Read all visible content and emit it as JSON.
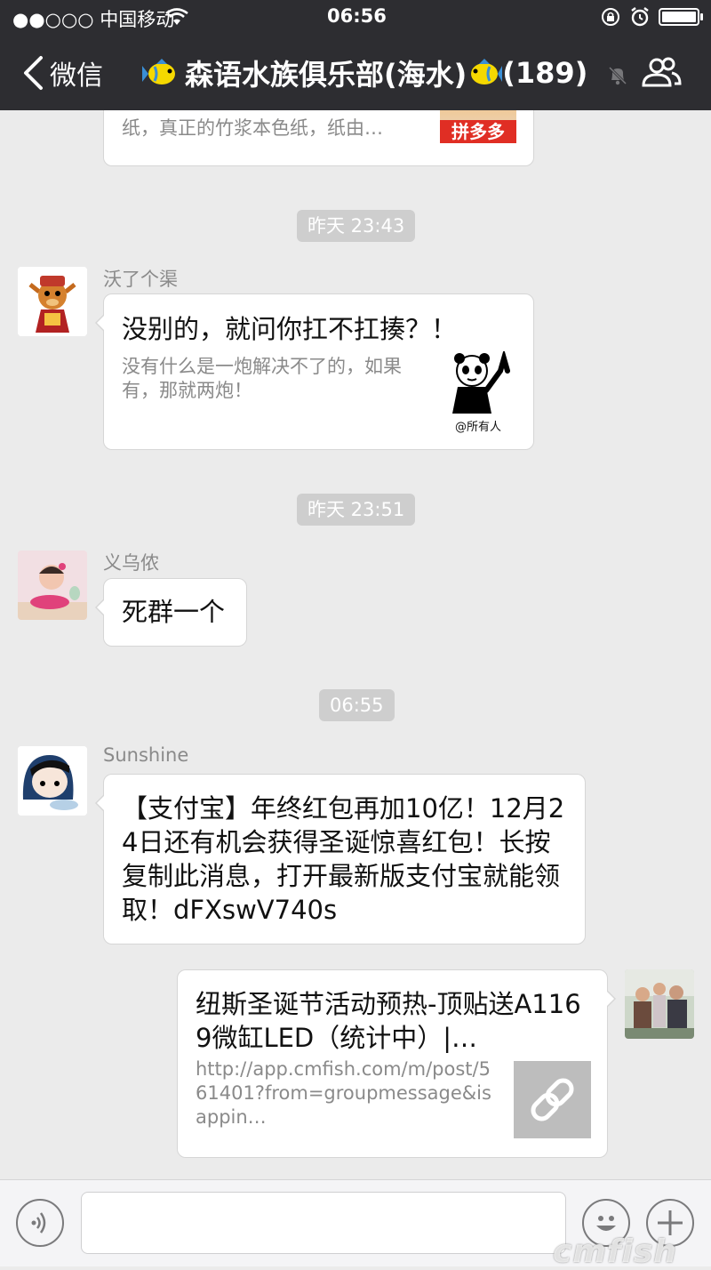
{
  "status_bar": {
    "carrier": "●●○○○ 中国移动",
    "time": "06:56"
  },
  "nav": {
    "back_label": "微信",
    "title": "森语水族俱乐部(海水)",
    "member_count": "(189)"
  },
  "messages": [
    {
      "kind": "card_partial",
      "desc": "纸，真正的竹浆本色纸，纸由…",
      "badge": "拼多多"
    },
    {
      "kind": "time",
      "text": "昨天 23:43"
    },
    {
      "kind": "card",
      "sender": "沃了个渠",
      "title": "没别的，就问你扛不扛揍？！",
      "desc": "没有什么是一炮解决不了的，如果有，那就两炮！",
      "thumb_caption": "@所有人"
    },
    {
      "kind": "time",
      "text": "昨天 23:51"
    },
    {
      "kind": "text",
      "sender": "义乌侬",
      "text": "死群一个"
    },
    {
      "kind": "time",
      "text": "06:55"
    },
    {
      "kind": "text",
      "sender": "Sunshine",
      "text": "【支付宝】年终红包再加10亿！12月24日还有机会获得圣诞惊喜红包！长按复制此消息，打开最新版支付宝就能领取！dFXswV740s"
    },
    {
      "kind": "link_self",
      "title": "纽斯圣诞节活动预热-顶贴送A1169微缸LED（统计中）|…",
      "url": "http://app.cmfish.com/m/post/561401?from=groupmessage&isappin…"
    }
  ],
  "watermark": "cmfish",
  "colors": {
    "nav_bg": "#2d2d31",
    "chat_bg": "#ebebeb",
    "badge_red": "#e02e24"
  }
}
